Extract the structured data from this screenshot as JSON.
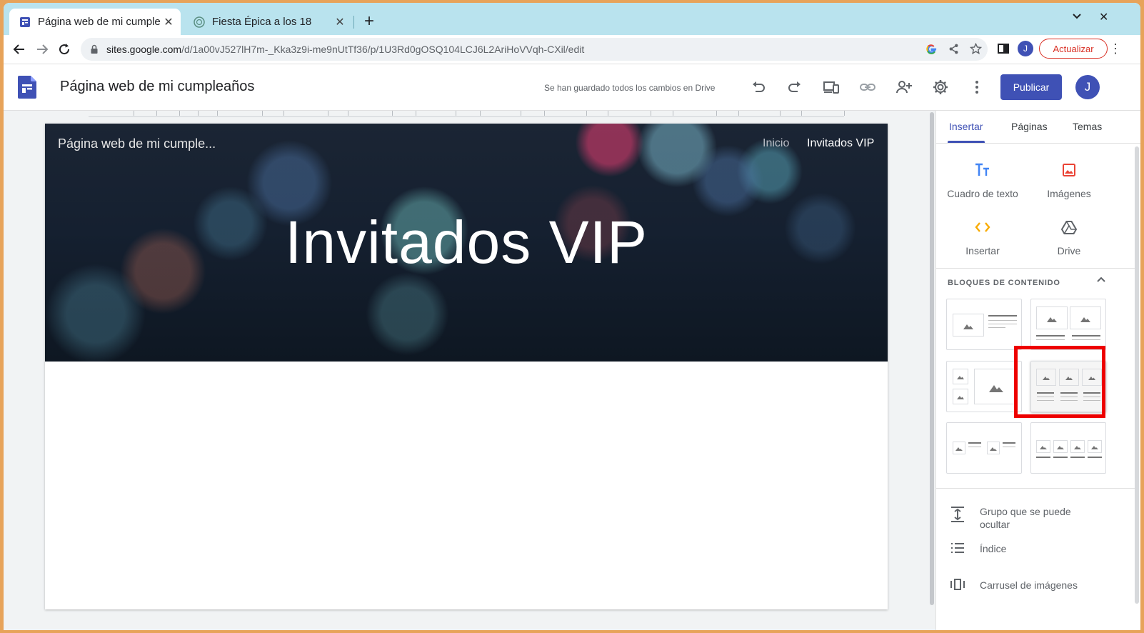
{
  "browser": {
    "tabs": [
      {
        "title": "Página web de mi cumpleaños",
        "active": true
      },
      {
        "title": "Fiesta Épica a los 18",
        "active": false
      }
    ],
    "url_host": "sites.google.com",
    "url_path": "/d/1a00vJ527lH7m-_Kka3z9i-me9nUtTf36/p/1U3Rd0gOSQ104LCJ6L2AriHoVVqh-CXil/edit",
    "profile_initial": "J",
    "update_label": "Actualizar"
  },
  "sites_header": {
    "doc_title": "Página web de mi cumpleaños",
    "save_status": "Se han guardado todos los cambios en Drive",
    "publish_label": "Publicar",
    "avatar_initial": "J"
  },
  "page": {
    "site_name": "Página web de mi cumple...",
    "nav": [
      "Inicio",
      "Invitados VIP"
    ],
    "hero_title": "Invitados VIP"
  },
  "panel": {
    "tabs": [
      "Insertar",
      "Páginas",
      "Temas"
    ],
    "insert_items": [
      "Cuadro de texto",
      "Imágenes",
      "Insertar",
      "Drive"
    ],
    "blocks_header": "BLOQUES DE CONTENIDO",
    "list_items": [
      "Grupo que se puede ocultar",
      "Índice",
      "Carrusel de imágenes"
    ]
  },
  "colors": {
    "accent": "#3f51b5",
    "tab_bar": "#b9e3ee",
    "highlight": "#ee0000",
    "update": "#d93025"
  }
}
